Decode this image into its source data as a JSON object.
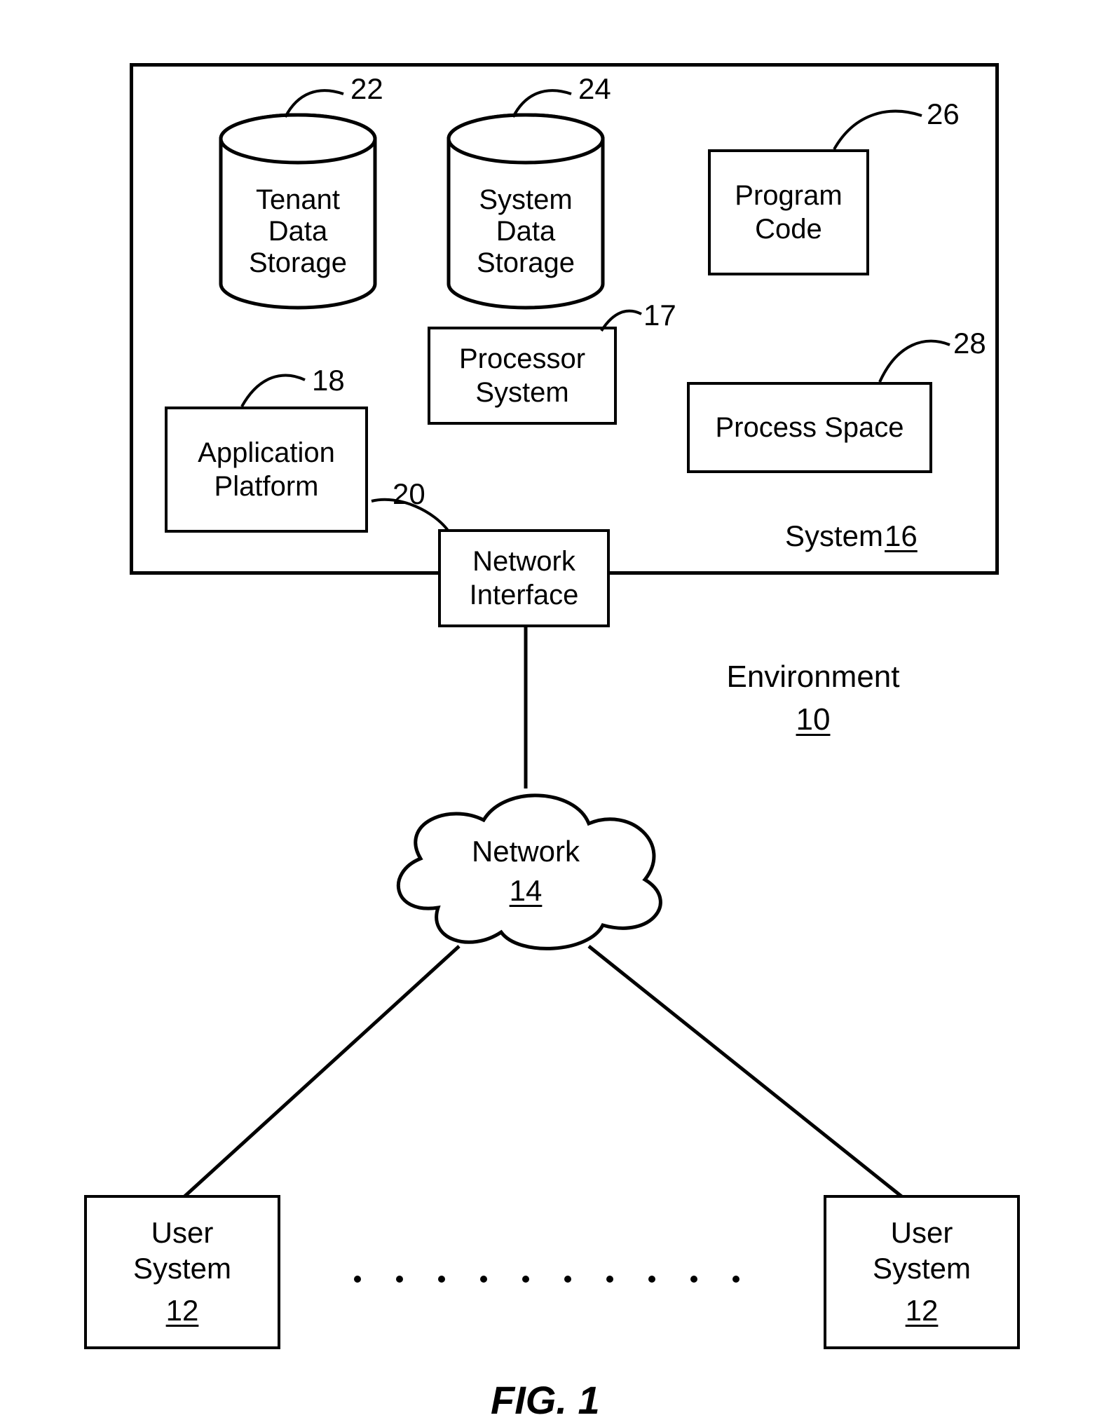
{
  "figure_caption": "FIG. 1",
  "system_box": {
    "label_name": "System",
    "label_num": "16"
  },
  "environment": {
    "name": "Environment",
    "num": "10"
  },
  "network": {
    "name": "Network",
    "num": "14"
  },
  "tenant_data_storage": {
    "text": "Tenant\nData\nStorage",
    "ref": "22"
  },
  "system_data_storage": {
    "text": "System\nData\nStorage",
    "ref": "24"
  },
  "program_code": {
    "text": "Program\nCode",
    "ref": "26"
  },
  "processor_system": {
    "text": "Processor\nSystem",
    "ref": "17"
  },
  "application_platform": {
    "text": "Application\nPlatform",
    "ref": "18"
  },
  "process_space": {
    "text": "Process Space",
    "ref": "28"
  },
  "network_interface": {
    "text": "Network\nInterface",
    "ref": "20"
  },
  "user_system_left": {
    "name": "User\nSystem",
    "num": "12"
  },
  "user_system_right": {
    "name": "User\nSystem",
    "num": "12"
  }
}
